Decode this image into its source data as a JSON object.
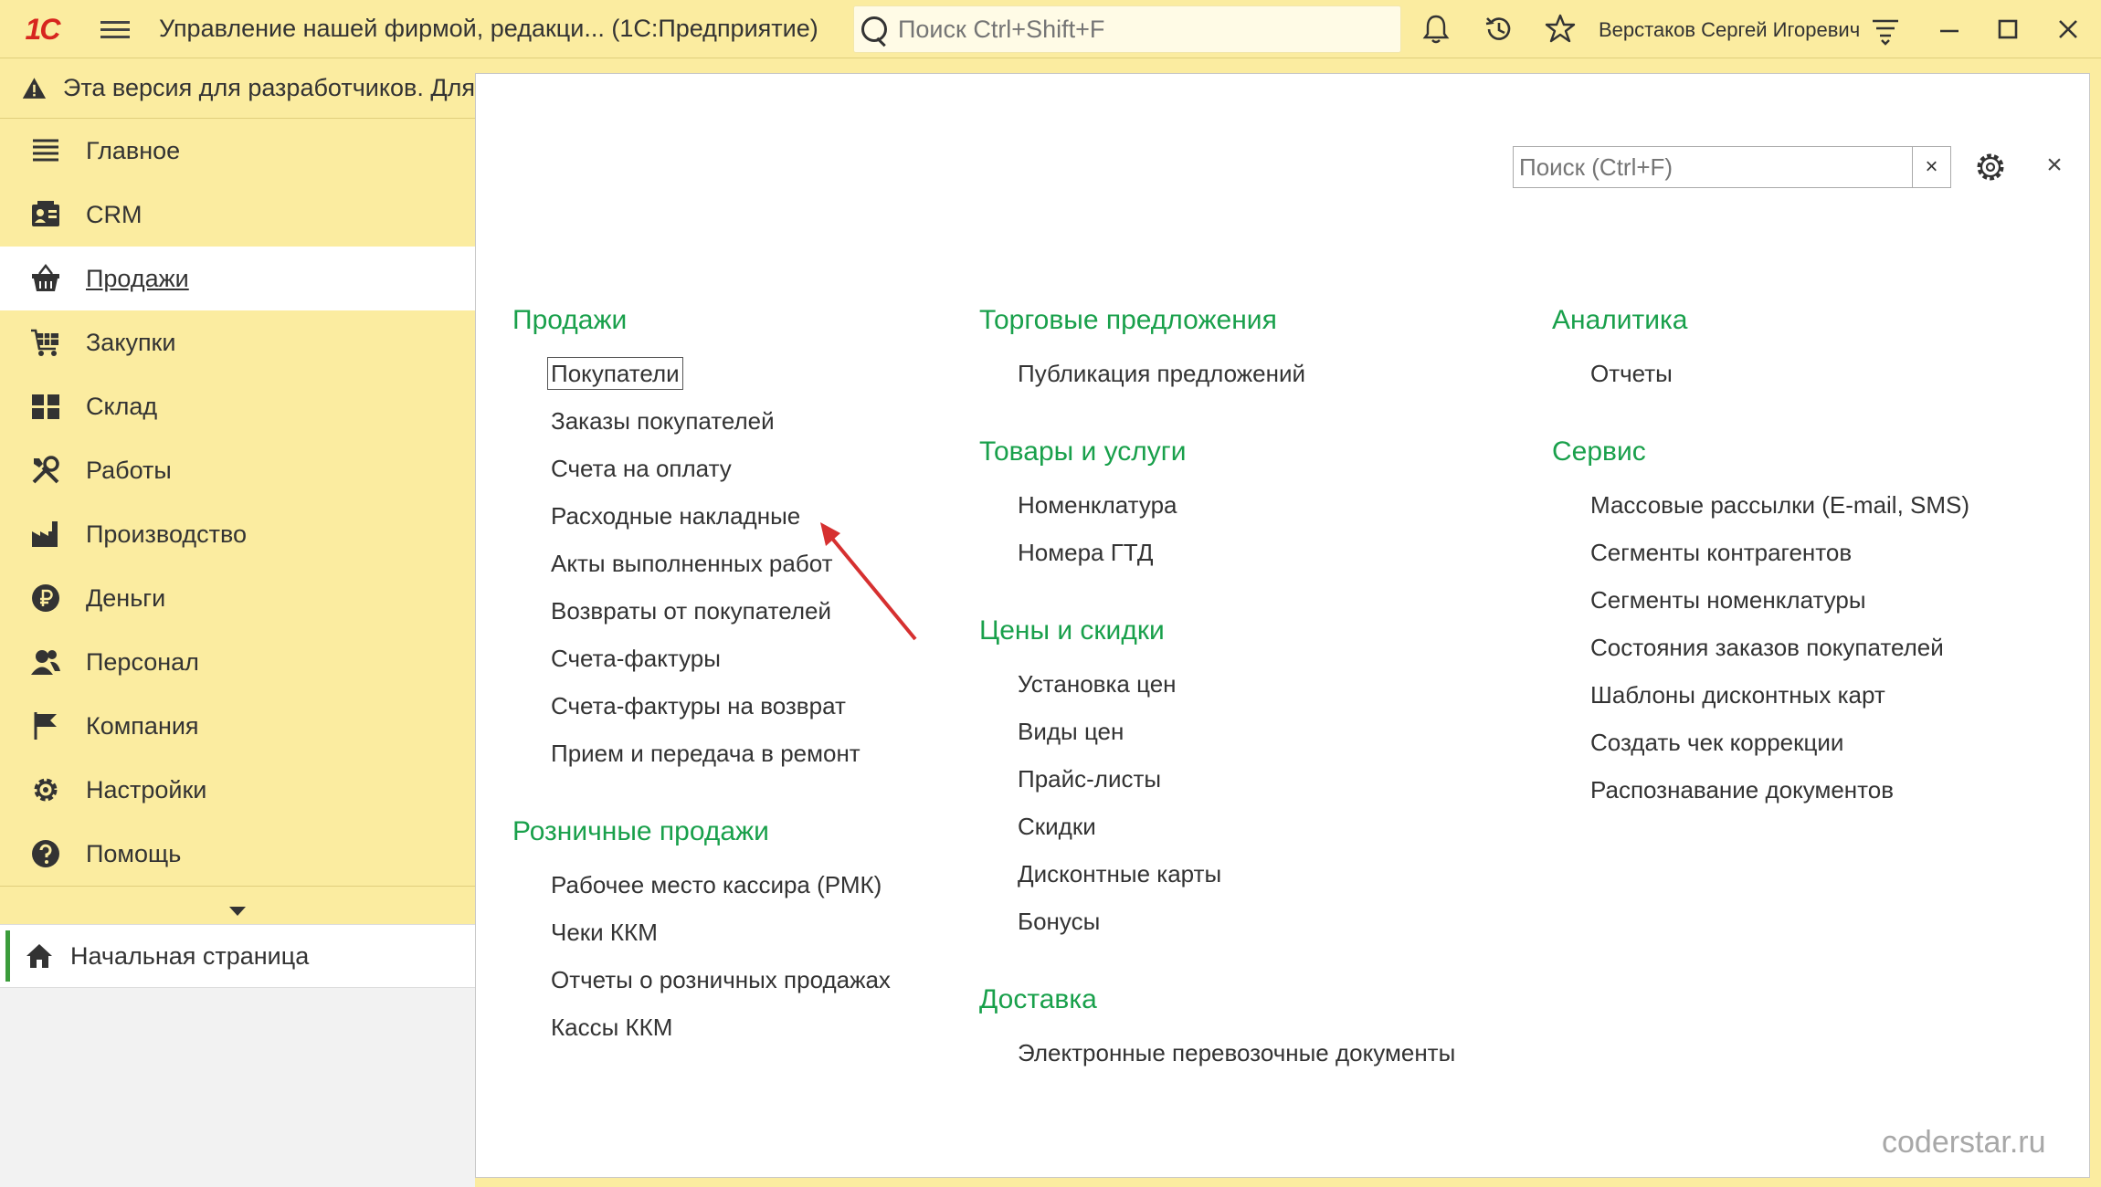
{
  "titlebar": {
    "logo": "1С",
    "app_title": "Управление нашей фирмой, редакци...   (1С:Предприятие)",
    "search_placeholder": "Поиск Ctrl+Shift+F",
    "user_name": "Верстаков Сергей Игоревич"
  },
  "warning": {
    "text": "Эта версия для разработчиков. Для"
  },
  "sidebar": {
    "items": [
      {
        "label": "Главное",
        "icon": "list-icon"
      },
      {
        "label": "CRM",
        "icon": "crm-icon"
      },
      {
        "label": "Продажи",
        "icon": "basket-icon",
        "active": true
      },
      {
        "label": "Закупки",
        "icon": "cart-icon"
      },
      {
        "label": "Склад",
        "icon": "warehouse-icon"
      },
      {
        "label": "Работы",
        "icon": "tools-icon"
      },
      {
        "label": "Производство",
        "icon": "factory-icon"
      },
      {
        "label": "Деньги",
        "icon": "ruble-icon"
      },
      {
        "label": "Персонал",
        "icon": "people-icon"
      },
      {
        "label": "Компания",
        "icon": "flag-icon"
      },
      {
        "label": "Настройки",
        "icon": "gear-icon"
      },
      {
        "label": "Помощь",
        "icon": "help-icon"
      }
    ],
    "home_label": "Начальная страница"
  },
  "main": {
    "search_placeholder": "Поиск (Ctrl+F)",
    "columns": [
      [
        {
          "title": "Продажи",
          "links": [
            "Покупатели",
            "Заказы покупателей",
            "Счета на оплату",
            "Расходные накладные",
            "Акты выполненных работ",
            "Возвраты от покупателей",
            "Счета-фактуры",
            "Счета-фактуры на возврат",
            "Прием и передача в ремонт"
          ]
        },
        {
          "title": "Розничные продажи",
          "links": [
            "Рабочее место кассира (РМК)",
            "Чеки ККМ",
            "Отчеты о розничных продажах",
            "Кассы ККМ"
          ]
        }
      ],
      [
        {
          "title": "Торговые предложения",
          "links": [
            "Публикация предложений"
          ]
        },
        {
          "title": "Товары и услуги",
          "links": [
            "Номенклатура",
            "Номера ГТД"
          ]
        },
        {
          "title": "Цены и скидки",
          "links": [
            "Установка цен",
            "Виды цен",
            "Прайс-листы",
            "Скидки",
            "Дисконтные карты",
            "Бонусы"
          ]
        },
        {
          "title": "Доставка",
          "links": [
            "Электронные перевозочные документы"
          ]
        }
      ],
      [
        {
          "title": "Аналитика",
          "links": [
            "Отчеты"
          ]
        },
        {
          "title": "Сервис",
          "links": [
            "Массовые рассылки (E-mail, SMS)",
            "Сегменты контрагентов",
            "Сегменты номенклатуры",
            "Состояния заказов покупателей",
            "Шаблоны дисконтных карт",
            "Создать чек коррекции",
            "Распознавание документов"
          ]
        }
      ]
    ]
  },
  "watermark": "coderstar.ru",
  "colors": {
    "panel_bg": "#fbeca0",
    "section_title": "#19a04b",
    "arrow": "#d63030"
  }
}
